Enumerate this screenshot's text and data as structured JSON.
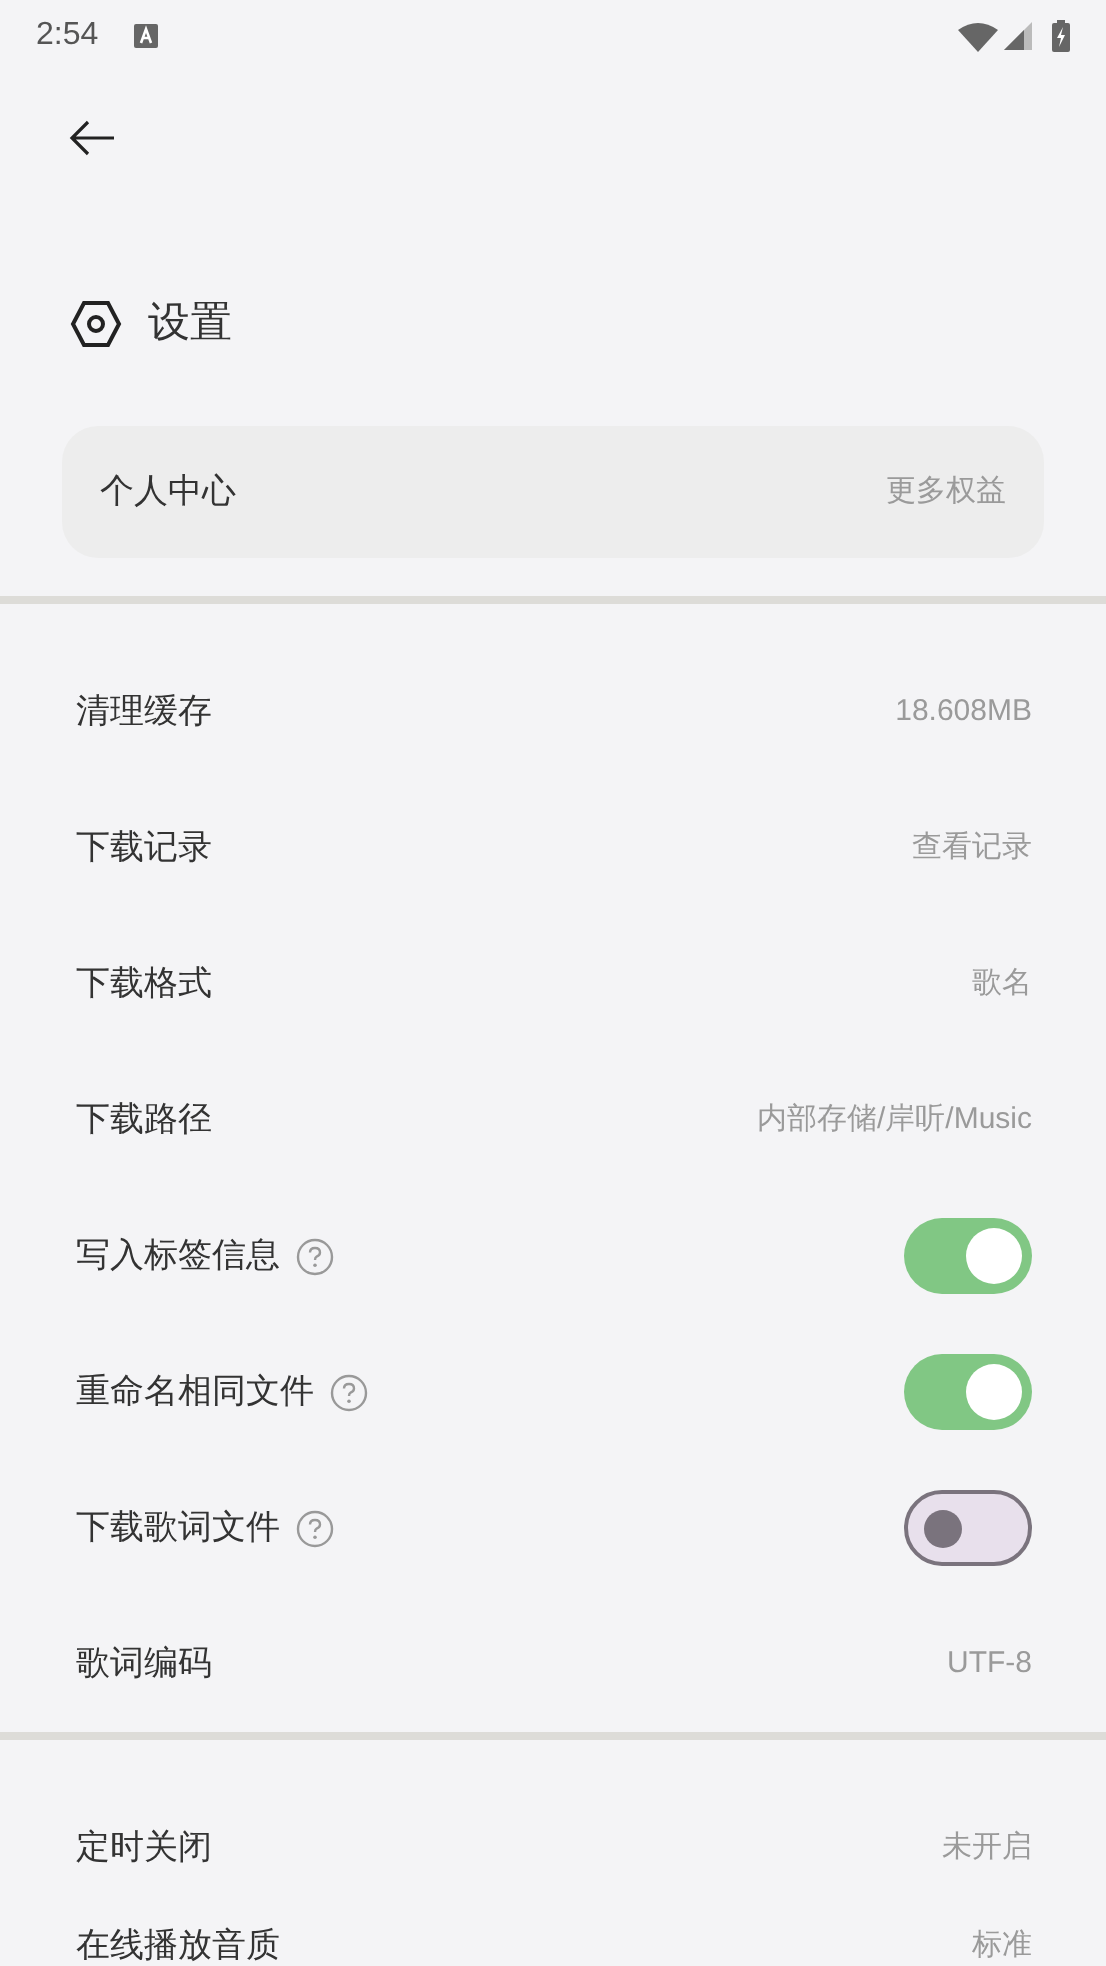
{
  "status_bar": {
    "time": "2:54"
  },
  "header": {
    "title": "设置"
  },
  "profile_card": {
    "label": "个人中心",
    "value": "更多权益"
  },
  "groups": [
    {
      "rows": [
        {
          "kind": "value",
          "label": "清理缓存",
          "value": "18.608MB"
        },
        {
          "kind": "value",
          "label": "下载记录",
          "value": "查看记录"
        },
        {
          "kind": "value",
          "label": "下载格式",
          "value": "歌名"
        },
        {
          "kind": "value",
          "label": "下载路径",
          "value": "内部存储/岸听/Music"
        },
        {
          "kind": "toggle",
          "label": "写入标签信息",
          "on": true
        },
        {
          "kind": "toggle",
          "label": "重命名相同文件",
          "on": true
        },
        {
          "kind": "toggle",
          "label": "下载歌词文件",
          "on": false
        },
        {
          "kind": "value",
          "label": "歌词编码",
          "value": "UTF-8"
        }
      ]
    },
    {
      "rows": [
        {
          "kind": "value",
          "label": "定时关闭",
          "value": "未开启"
        },
        {
          "kind": "value",
          "label": "在线播放音质",
          "value": "标准"
        }
      ]
    }
  ]
}
